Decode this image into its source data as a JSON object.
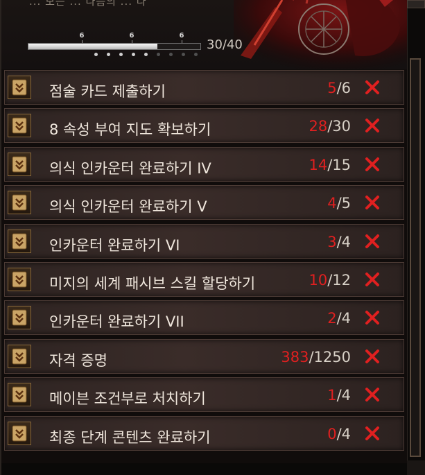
{
  "header": {
    "partial_text": "... 보는 ... 다음의 ... 다",
    "progress_current": 30,
    "progress_max": 40,
    "progress_text": "30/40",
    "milestones": [
      "6",
      "6",
      "6"
    ]
  },
  "colors": {
    "current_count": "#e02020",
    "label": "#efe6dc",
    "close_x": "#e02020"
  },
  "tasks": [
    {
      "label": "점술 카드 제출하기",
      "current": "5",
      "total": "/6"
    },
    {
      "label": "8 속성 부여 지도 확보하기",
      "current": "28",
      "total": "/30"
    },
    {
      "label": "의식 인카운터 완료하기 IV",
      "current": "14",
      "total": "/15"
    },
    {
      "label": "의식 인카운터 완료하기 V",
      "current": "4",
      "total": "/5"
    },
    {
      "label": "인카운터 완료하기 VI",
      "current": "3",
      "total": "/4"
    },
    {
      "label": "미지의 세계 패시브 스킬 할당하기",
      "current": "10",
      "total": "/12"
    },
    {
      "label": "인카운터 완료하기 VII",
      "current": "2",
      "total": "/4"
    },
    {
      "label": "자격 증명",
      "current": "383",
      "total": "/1250"
    },
    {
      "label": "메이븐 조건부로 처치하기",
      "current": "1",
      "total": "/4"
    },
    {
      "label": "최종 단계 콘텐츠 완료하기",
      "current": "0",
      "total": "/4"
    }
  ],
  "icons": {
    "row_icon": "scroll-chevron-icon",
    "remove_icon": "red-x-icon"
  }
}
